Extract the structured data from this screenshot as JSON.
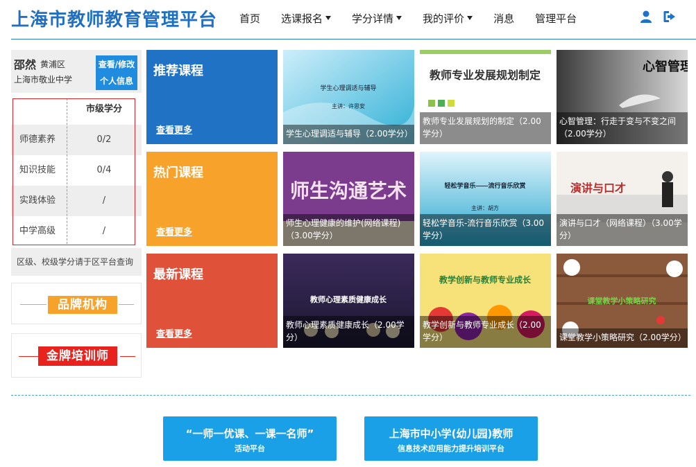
{
  "header": {
    "logo": "上海市教师教育管理平台",
    "nav": [
      {
        "label": "首页",
        "dropdown": false
      },
      {
        "label": "选课报名",
        "dropdown": true
      },
      {
        "label": "学分详情",
        "dropdown": true
      },
      {
        "label": "我的评价",
        "dropdown": true
      },
      {
        "label": "消息",
        "dropdown": false
      },
      {
        "label": "管理平台",
        "dropdown": false
      }
    ],
    "icons": [
      "user-icon",
      "logout-icon"
    ],
    "accent": "#1f6fc2"
  },
  "user": {
    "name": "邵然",
    "district": "黄浦区",
    "school": "上海市敬业中学",
    "edit_line1": "查看/修改",
    "edit_line2": "个人信息"
  },
  "credits": {
    "header": "市级学分",
    "rows": [
      {
        "category": "师德素养",
        "value": "0/2"
      },
      {
        "category": "知识技能",
        "value": "0/4"
      },
      {
        "category": "实践体验",
        "value": "/"
      },
      {
        "category": "中学高级",
        "value": "/"
      }
    ],
    "note": "区级、校级学分请于区平台查询"
  },
  "brands": [
    {
      "label": "品牌机构",
      "color": "#f7a22b"
    },
    {
      "label": "金牌培训师",
      "color": "#e8231e"
    }
  ],
  "sections": [
    {
      "title": "推荐课程",
      "more": "查看更多",
      "color": "#1f72c4",
      "courses": [
        {
          "caption": "学生心理调适与辅导（2.00学分）",
          "thumb_text": "学生心理调适与辅导",
          "thumb_sub": "主讲：许思安"
        },
        {
          "caption": "教师专业发展规划的制定（2.00学分）",
          "thumb_text": "教师专业发展规划制定"
        },
        {
          "caption": "心智管理：行走于变与不变之间（2.00学分）",
          "thumb_text": "心智管理"
        }
      ]
    },
    {
      "title": "热门课程",
      "more": "查看更多",
      "color": "#f7a22b",
      "courses": [
        {
          "caption": "师生心理健康的维护(网络课程)（3.00学分）",
          "thumb_text": "师生沟通艺术"
        },
        {
          "caption": "轻松学音乐-流行音乐欣赏（3.00学分）",
          "thumb_text": "轻松学音乐——流行音乐欣赏",
          "thumb_sub": "主讲：胡方"
        },
        {
          "caption": "演讲与口才（网络课程）（3.00学分）",
          "thumb_text": "演讲与口才"
        }
      ]
    },
    {
      "title": "最新课程",
      "more": "查看更多",
      "color": "#e0513a",
      "courses": [
        {
          "caption": "教师心理素质健康成长（2.00学分）",
          "thumb_text": "教师心理素质健康成长"
        },
        {
          "caption": "教学创新与教师专业成长（2.00学分）",
          "thumb_text": "教学创新与教师专业成长"
        },
        {
          "caption": "课堂教学小策略研究（2.00学分）",
          "thumb_text": "课堂教学小策略研究"
        }
      ]
    }
  ],
  "bottom_buttons": [
    {
      "line1": "“一师一优课、一课一名师”",
      "line2": "活动平台"
    },
    {
      "line1": "上海市中小学(幼儿园)教师",
      "line2": "信息技术应用能力提升培训平台"
    }
  ]
}
